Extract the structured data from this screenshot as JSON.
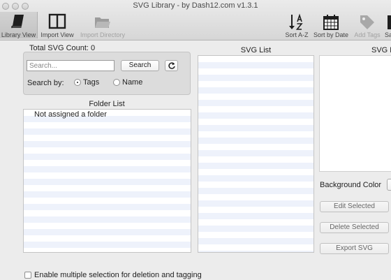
{
  "window": {
    "title": "SVG Library - by Dash12.com  v1.3.1"
  },
  "toolbar": {
    "library_view": "Library View",
    "import_view": "Import View",
    "import_directory": "Import Directory",
    "sort_az": "Sort A-Z",
    "sort_by_date": "Sort by Date",
    "add_tags": "Add Tags",
    "save_partial": "Sa"
  },
  "search_panel": {
    "total_count": "Total SVG Count: 0",
    "placeholder": "Search...",
    "search_button": "Search",
    "search_by_label": "Search by:",
    "option_tags": "Tags",
    "option_name": "Name",
    "selected_option": "Tags"
  },
  "folder_list": {
    "title": "Folder List",
    "items": [
      "Not assigned a folder"
    ]
  },
  "svg_list": {
    "title": "SVG List"
  },
  "preview": {
    "title_partial": "SVG F",
    "background_color_label": "Background Color",
    "edit_selected": "Edit Selected",
    "delete_selected": "Delete Selected",
    "export_svg": "Export SVG"
  },
  "footer": {
    "multi_select_label": "Enable multiple selection for deletion and tagging"
  },
  "icons": {
    "library_view": "book-icon",
    "import_view": "columns-icon",
    "import_directory": "folder-icon",
    "sort_az": "sort-alpha-icon",
    "sort_by_date": "calendar-icon",
    "add_tags": "tag-icon",
    "refresh": "refresh-icon"
  }
}
